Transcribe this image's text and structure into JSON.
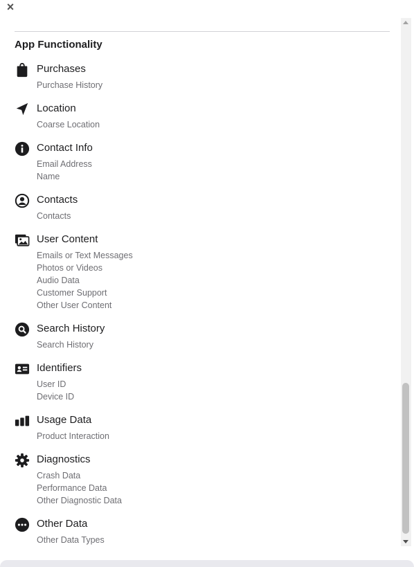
{
  "close_label": "×",
  "section_title": "App Functionality",
  "categories": [
    {
      "icon": "shopping-bag-icon",
      "title": "Purchases",
      "items": [
        "Purchase History"
      ]
    },
    {
      "icon": "location-arrow-icon",
      "title": "Location",
      "items": [
        "Coarse Location"
      ]
    },
    {
      "icon": "info-circle-icon",
      "title": "Contact Info",
      "items": [
        "Email Address",
        "Name"
      ]
    },
    {
      "icon": "user-circle-icon",
      "title": "Contacts",
      "items": [
        "Contacts"
      ]
    },
    {
      "icon": "photos-icon",
      "title": "User Content",
      "items": [
        "Emails or Text Messages",
        "Photos or Videos",
        "Audio Data",
        "Customer Support",
        "Other User Content"
      ]
    },
    {
      "icon": "search-circle-icon",
      "title": "Search History",
      "items": [
        "Search History"
      ]
    },
    {
      "icon": "id-card-icon",
      "title": "Identifiers",
      "items": [
        "User ID",
        "Device ID"
      ]
    },
    {
      "icon": "bar-chart-icon",
      "title": "Usage Data",
      "items": [
        "Product Interaction"
      ]
    },
    {
      "icon": "gear-icon",
      "title": "Diagnostics",
      "items": [
        "Crash Data",
        "Performance Data",
        "Other Diagnostic Data"
      ]
    },
    {
      "icon": "more-circle-icon",
      "title": "Other Data",
      "items": [
        "Other Data Types"
      ]
    }
  ]
}
